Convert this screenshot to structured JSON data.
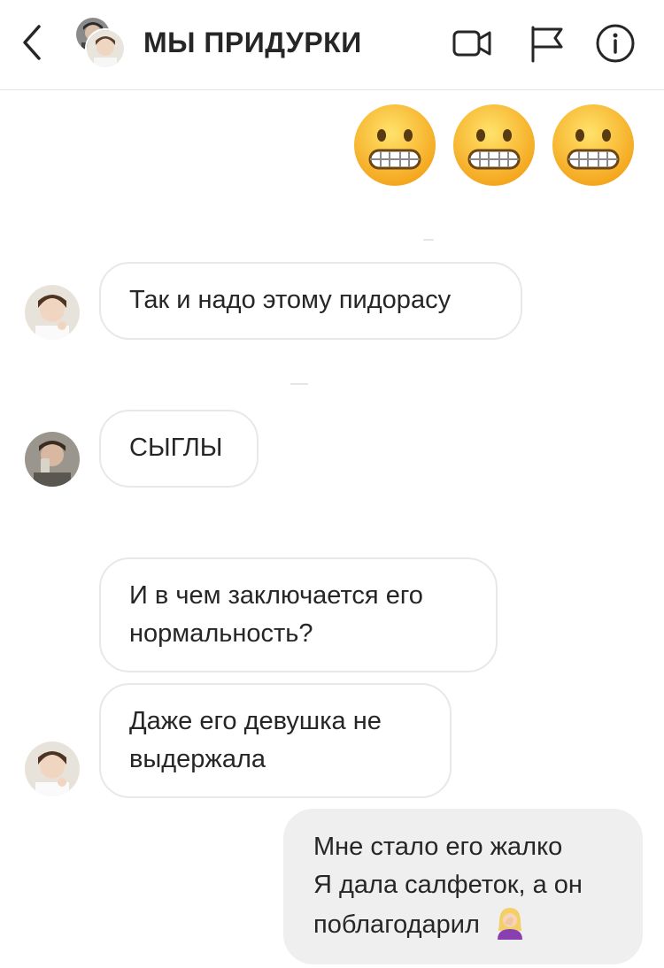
{
  "header": {
    "title": "МЫ ПРИДУРКИ",
    "icons": [
      "back-icon",
      "video-call-icon",
      "flag-icon",
      "info-icon"
    ]
  },
  "messages": [
    {
      "type": "emoji",
      "from": "me",
      "emojis": [
        "grimacing-face",
        "grimacing-face",
        "grimacing-face"
      ]
    },
    {
      "from": "other",
      "lines": [
        "Так и надо этому пидорасу"
      ]
    },
    {
      "from": "other",
      "lines": [
        "СЫГЛЫ"
      ]
    },
    {
      "from": "other",
      "lines": [
        "И в чем заключается его",
        "нормальность?"
      ]
    },
    {
      "from": "other",
      "lines": [
        "Даже его девушка не",
        "выдержала"
      ]
    },
    {
      "from": "me",
      "lines": [
        "Мне стало его жалко",
        "Я дала салфеток, а он",
        "поблагодарил"
      ],
      "trailing_emoji": "face-palm-woman"
    }
  ],
  "colors": {
    "incoming_border": "#e8e8e8",
    "outgoing_bg": "#efefef",
    "text": "#262626"
  }
}
